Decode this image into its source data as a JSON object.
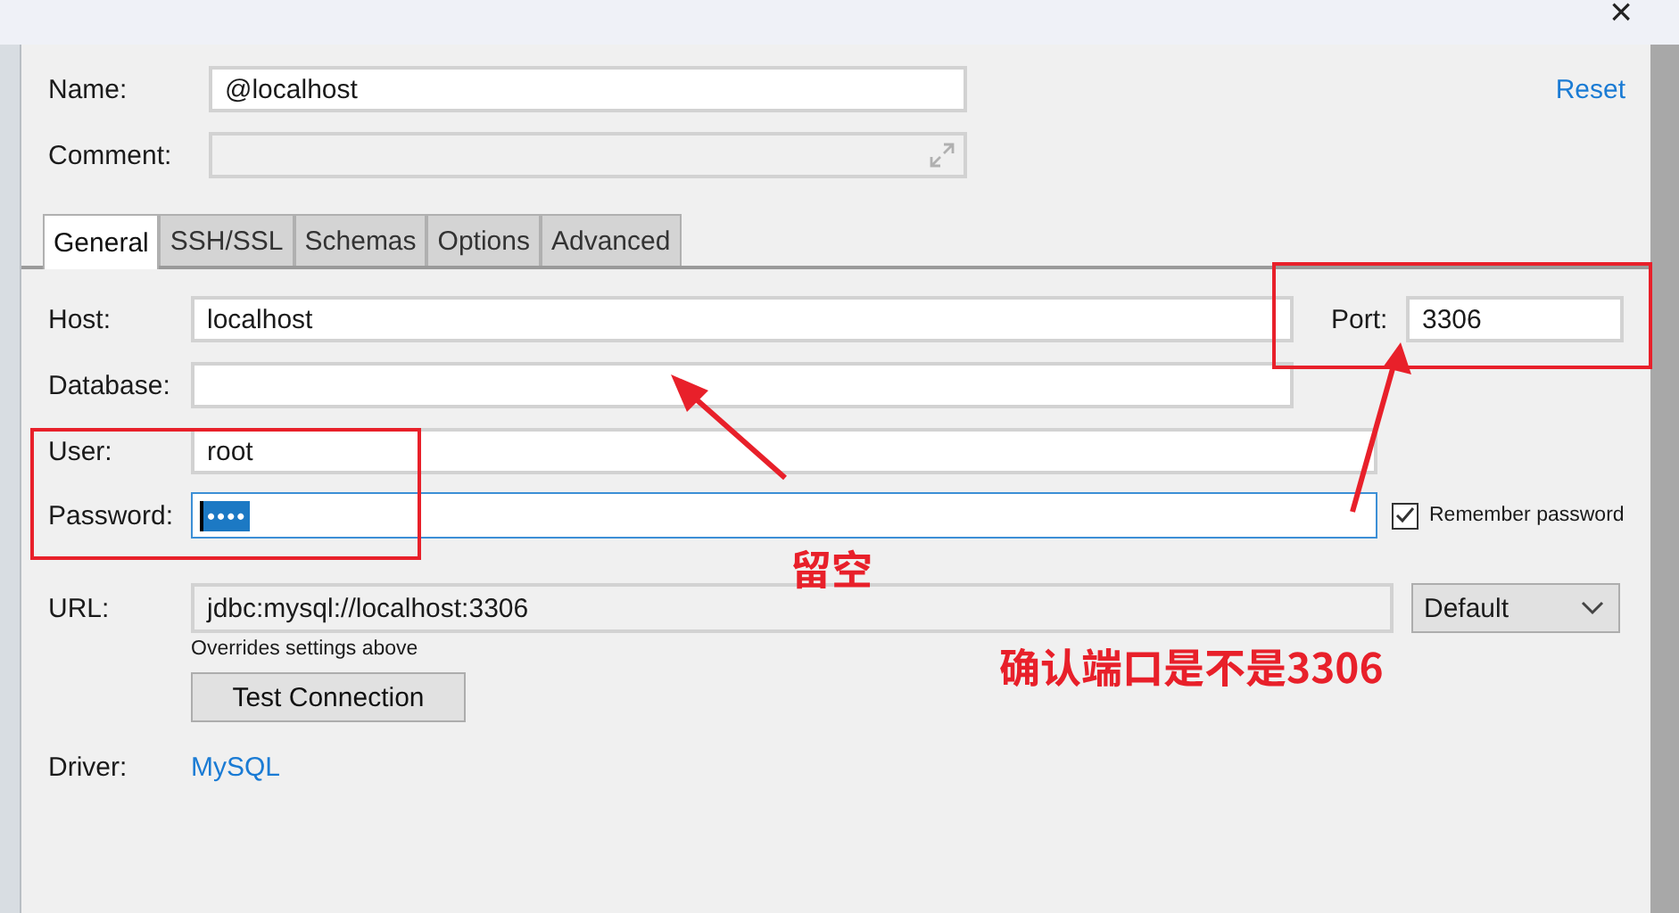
{
  "window": {
    "close": "×"
  },
  "name": {
    "label": "Name:",
    "value": "@localhost"
  },
  "comment": {
    "label": "Comment:"
  },
  "reset_link": "Reset",
  "tabs": [
    {
      "label": "General",
      "selected": true
    },
    {
      "label": "SSH/SSL",
      "selected": false
    },
    {
      "label": "Schemas",
      "selected": false
    },
    {
      "label": "Options",
      "selected": false
    },
    {
      "label": "Advanced",
      "selected": false
    }
  ],
  "host": {
    "label": "Host:",
    "value": "localhost"
  },
  "port": {
    "label": "Port:",
    "value": "3306"
  },
  "database": {
    "label": "Database:"
  },
  "user": {
    "label": "User:",
    "value": "root"
  },
  "password": {
    "label": "Password:",
    "mask": "••••",
    "focused": true
  },
  "remember_password": {
    "label": "Remember password",
    "checked": true
  },
  "url": {
    "label": "URL:",
    "value": "jdbc:mysql://localhost:3306",
    "hint": "Overrides settings above"
  },
  "url_mode": {
    "value": "Default"
  },
  "test_button": "Test Connection",
  "driver": {
    "label": "Driver:",
    "value": "MySQL"
  },
  "annotations": [
    {
      "text": "留空"
    },
    {
      "text": "确认端口是不是3306"
    }
  ]
}
